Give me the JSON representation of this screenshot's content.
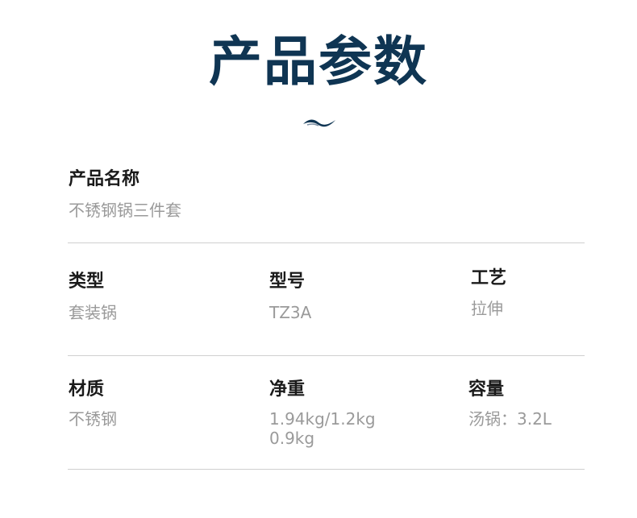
{
  "title": "产品参数",
  "decoration": {
    "icon": "wave-icon",
    "color_dark": "#0f3553",
    "color_light": "#7d8fa3"
  },
  "colors": {
    "title": "#0f3553",
    "label": "#1a1a1a",
    "value": "#9a9a9a",
    "divider": "#cfcfcf"
  },
  "product_name": {
    "label": "产品名称",
    "value": "不锈钢锅三件套"
  },
  "type": {
    "label": "类型",
    "value": "套装锅"
  },
  "model": {
    "label": "型号",
    "value": "TZ3A"
  },
  "craft": {
    "label": "工艺",
    "value": "拉伸"
  },
  "material": {
    "label": "材质",
    "value": "不锈钢"
  },
  "net_weight": {
    "label": "净重",
    "value": "1.94kg/1.2kg\n0.9kg"
  },
  "capacity": {
    "label": "容量",
    "value": "汤锅：3.2L"
  }
}
